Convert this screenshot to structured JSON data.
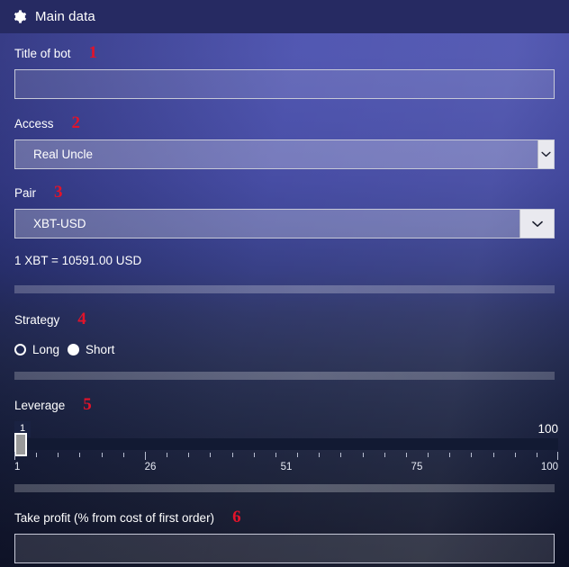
{
  "window": {
    "title": "Main data",
    "icon": "gear-icon"
  },
  "colors": {
    "titlebar": "#262a62",
    "annotation_red": "#e3132a",
    "background_top": "#4a4fb0",
    "background_bottom": "#0b0f22"
  },
  "fields": {
    "title_of_bot": {
      "label": "Title of bot",
      "annotation": "1",
      "value": "",
      "placeholder": ""
    },
    "access": {
      "label": "Access",
      "annotation": "2",
      "value": "Real Uncle",
      "arrow_icon": "chevron-down-icon"
    },
    "pair": {
      "label": "Pair",
      "annotation": "3",
      "value": "XBT-USD",
      "arrow_icon": "chevron-down-icon",
      "rate": "1 XBT = 10591.00 USD"
    },
    "strategy": {
      "label": "Strategy",
      "annotation": "4",
      "options": [
        {
          "label": "Long",
          "state": "ring"
        },
        {
          "label": "Short",
          "state": "solid"
        }
      ]
    },
    "leverage": {
      "label": "Leverage",
      "annotation": "5",
      "current_value": "1",
      "max_label": "100",
      "min": 1,
      "max": 100,
      "handle_position_percent": 0,
      "tick_labels": [
        "1",
        "26",
        "51",
        "75",
        "100"
      ],
      "tick_label_positions_percent": [
        0,
        25,
        50,
        74,
        100
      ],
      "minor_tick_count": 25
    },
    "take_profit": {
      "label": "Take profit (% from cost of first order)",
      "annotation": "6",
      "value": "",
      "placeholder": ""
    }
  }
}
